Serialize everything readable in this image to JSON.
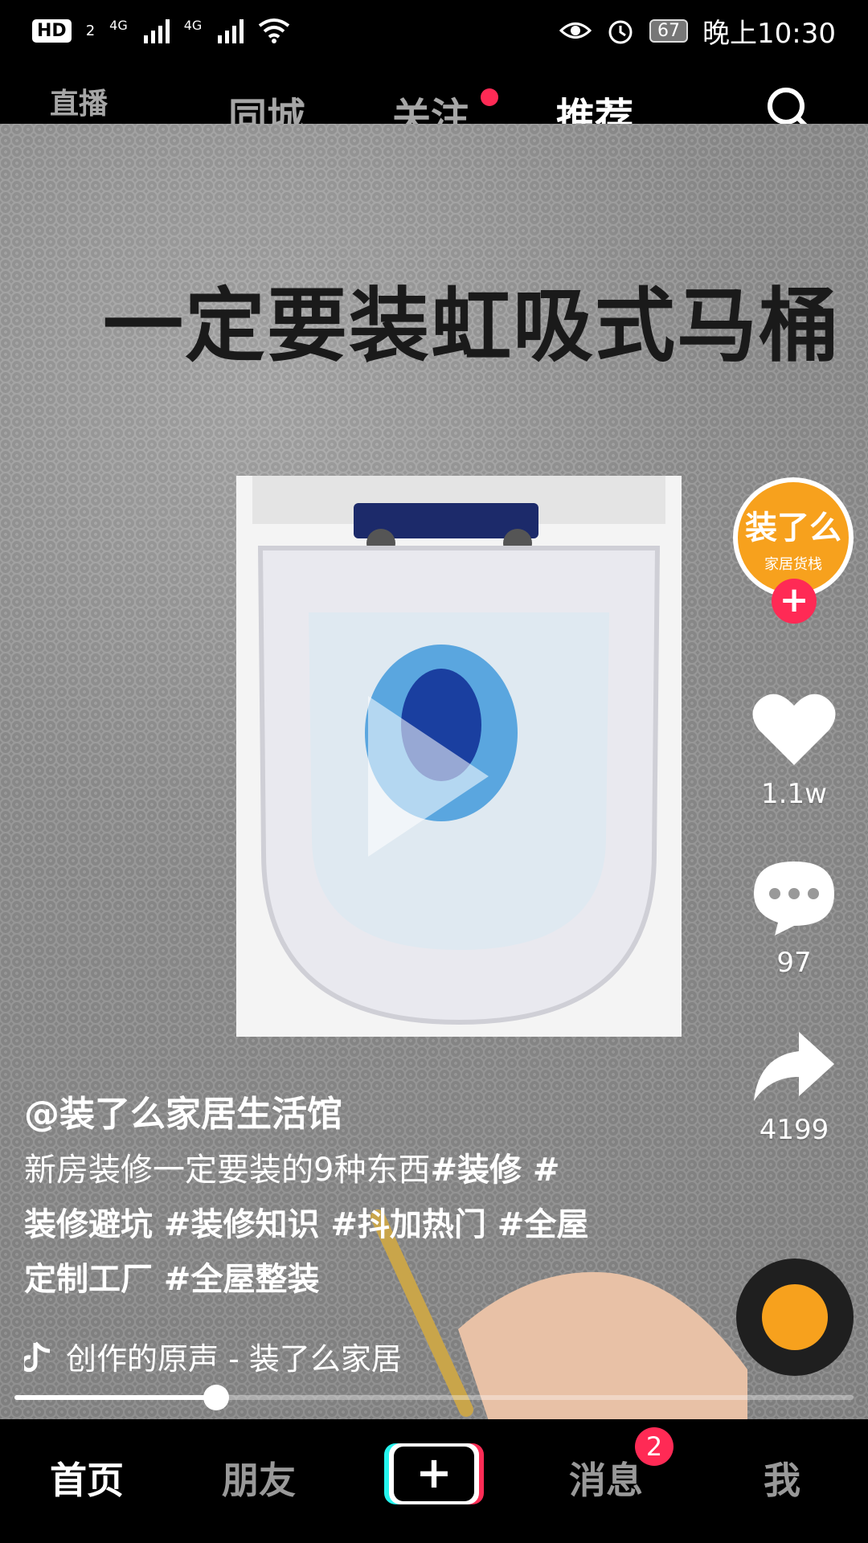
{
  "status_bar": {
    "hd": "HD",
    "sim": "2",
    "net1": "4G",
    "net2": "4G",
    "battery": "67",
    "time": "晚上10:30"
  },
  "top_nav": {
    "live": "直播",
    "local": "同城",
    "follow": "关注",
    "recommend": "推荐"
  },
  "video": {
    "headline": "一定要装虹吸式马桶"
  },
  "actions": {
    "avatar_text": "家居货栈",
    "likes": "1.1w",
    "comments": "97",
    "shares": "4199"
  },
  "post": {
    "author": "@装了么家居生活馆",
    "desc_plain": "新房装修一定要装的9种东西",
    "tags": [
      "#装修 #",
      "装修避坑 #装修知识 #抖加热门 #全屋",
      "定制工厂 #全屋整装"
    ],
    "music": "创作的原声 - 装了么家居"
  },
  "progress": {
    "value": 0.24
  },
  "tabbar": {
    "home": "首页",
    "friends": "朋友",
    "messages": "消息",
    "message_badge": "2",
    "me": "我",
    "plus": "+"
  },
  "colors": {
    "accent_red": "#ff2a55",
    "avatar_orange": "#f7a11d"
  }
}
